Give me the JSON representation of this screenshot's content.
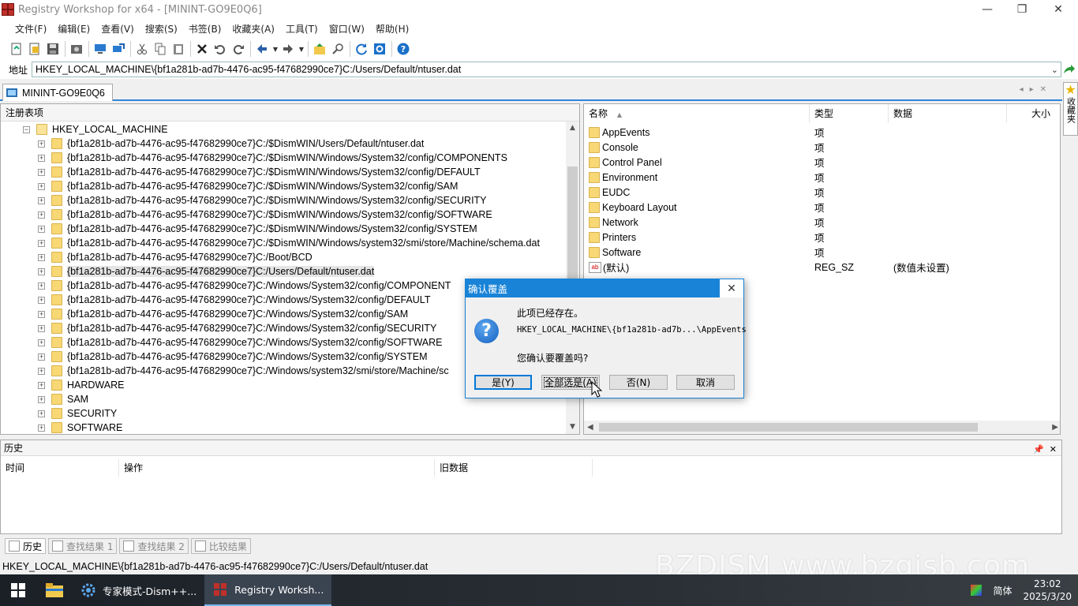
{
  "window": {
    "title": "Registry Workshop for x64 - [MININT-GO9E0Q6]",
    "min": "—",
    "restore": "❐",
    "close": "✕"
  },
  "menu": [
    "文件(F)",
    "编辑(E)",
    "查看(V)",
    "搜索(S)",
    "书签(B)",
    "收藏夹(A)",
    "工具(T)",
    "窗口(W)",
    "帮助(H)"
  ],
  "address": {
    "label": "地址",
    "value": "HKEY_LOCAL_MACHINE\\{bf1a281b-ad7b-4476-ac95-f47682990ce7}C:/Users/Default/ntuser.dat"
  },
  "doc_tab": "MININT-GO9E0Q6",
  "favorites_label": "收藏夹",
  "tree": {
    "header": "注册表项",
    "root": "HKEY_LOCAL_MACHINE",
    "items": [
      "{bf1a281b-ad7b-4476-ac95-f47682990ce7}C:/$DismWIN/Users/Default/ntuser.dat",
      "{bf1a281b-ad7b-4476-ac95-f47682990ce7}C:/$DismWIN/Windows/System32/config/COMPONENTS",
      "{bf1a281b-ad7b-4476-ac95-f47682990ce7}C:/$DismWIN/Windows/System32/config/DEFAULT",
      "{bf1a281b-ad7b-4476-ac95-f47682990ce7}C:/$DismWIN/Windows/System32/config/SAM",
      "{bf1a281b-ad7b-4476-ac95-f47682990ce7}C:/$DismWIN/Windows/System32/config/SECURITY",
      "{bf1a281b-ad7b-4476-ac95-f47682990ce7}C:/$DismWIN/Windows/System32/config/SOFTWARE",
      "{bf1a281b-ad7b-4476-ac95-f47682990ce7}C:/$DismWIN/Windows/System32/config/SYSTEM",
      "{bf1a281b-ad7b-4476-ac95-f47682990ce7}C:/$DismWIN/Windows/system32/smi/store/Machine/schema.dat",
      "{bf1a281b-ad7b-4476-ac95-f47682990ce7}C:/Boot/BCD",
      "{bf1a281b-ad7b-4476-ac95-f47682990ce7}C:/Users/Default/ntuser.dat",
      "{bf1a281b-ad7b-4476-ac95-f47682990ce7}C:/Windows/System32/config/COMPONENT",
      "{bf1a281b-ad7b-4476-ac95-f47682990ce7}C:/Windows/System32/config/DEFAULT",
      "{bf1a281b-ad7b-4476-ac95-f47682990ce7}C:/Windows/System32/config/SAM",
      "{bf1a281b-ad7b-4476-ac95-f47682990ce7}C:/Windows/System32/config/SECURITY",
      "{bf1a281b-ad7b-4476-ac95-f47682990ce7}C:/Windows/System32/config/SOFTWARE",
      "{bf1a281b-ad7b-4476-ac95-f47682990ce7}C:/Windows/System32/config/SYSTEM",
      "{bf1a281b-ad7b-4476-ac95-f47682990ce7}C:/Windows/system32/smi/store/Machine/sc",
      "HARDWARE",
      "SAM",
      "SECURITY",
      "SOFTWARE"
    ],
    "selected_index": 9
  },
  "list": {
    "columns": {
      "name": "名称",
      "type": "类型",
      "data": "数据",
      "size": "大小"
    },
    "rows": [
      {
        "name": "AppEvents",
        "type": "项",
        "data": ""
      },
      {
        "name": "Console",
        "type": "项",
        "data": ""
      },
      {
        "name": "Control Panel",
        "type": "项",
        "data": ""
      },
      {
        "name": "Environment",
        "type": "项",
        "data": ""
      },
      {
        "name": "EUDC",
        "type": "项",
        "data": ""
      },
      {
        "name": "Keyboard Layout",
        "type": "项",
        "data": ""
      },
      {
        "name": "Network",
        "type": "项",
        "data": ""
      },
      {
        "name": "Printers",
        "type": "项",
        "data": ""
      },
      {
        "name": "Software",
        "type": "项",
        "data": ""
      }
    ],
    "default_value": {
      "name": "(默认)",
      "type": "REG_SZ",
      "data": "(数值未设置)"
    }
  },
  "history": {
    "title": "历史",
    "columns": [
      "时间",
      "操作",
      "旧数据"
    ]
  },
  "bottom_tabs": [
    "历史",
    "查找结果 1",
    "查找结果 2",
    "比较结果"
  ],
  "status": {
    "path": "HKEY_LOCAL_MACHINE\\{bf1a281b-ad7b-4476-ac95-f47682990ce7}C:/Users/Default/ntuser.dat",
    "watermark": "BZDJSM www.bzgjsb.com"
  },
  "taskbar": {
    "items": [
      "专家模式-Dism++...",
      "Registry Worksh..."
    ],
    "ime": "简体",
    "time": "23:02",
    "date": "2025/3/20"
  },
  "dialog": {
    "title": "确认覆盖",
    "line1": "此项已经存在。",
    "line2": "HKEY_LOCAL_MACHINE\\{bf1a281b-ad7b...\\AppEvents",
    "line3": "您确认要覆盖吗?",
    "buttons": {
      "yes": "是(Y)",
      "yes_all": "全部选是(A)",
      "no": "否(N)",
      "cancel": "取消"
    }
  }
}
